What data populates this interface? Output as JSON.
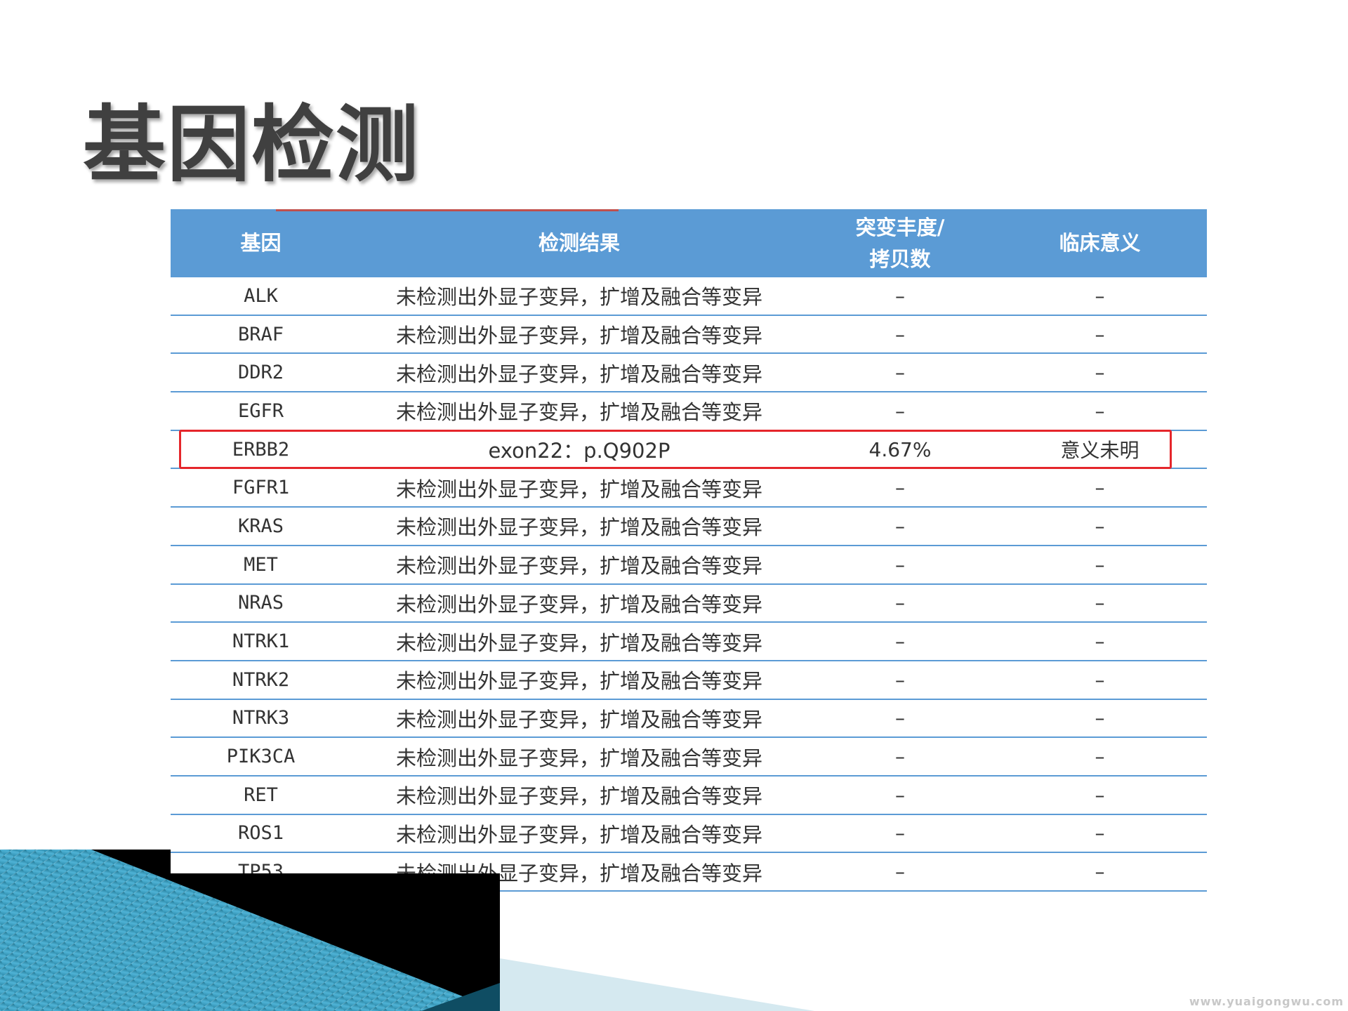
{
  "title": "基因检测",
  "table": {
    "headers": [
      "基因",
      "检测结果",
      "突变丰度/\n拷贝数",
      "临床意义"
    ],
    "rows": [
      {
        "gene": "ALK",
        "result": "未检测出外显子变异，扩增及融合等变异",
        "abundance": "–",
        "significance": "–"
      },
      {
        "gene": "BRAF",
        "result": "未检测出外显子变异，扩增及融合等变异",
        "abundance": "–",
        "significance": "–"
      },
      {
        "gene": "DDR2",
        "result": "未检测出外显子变异，扩增及融合等变异",
        "abundance": "–",
        "significance": "–"
      },
      {
        "gene": "EGFR",
        "result": "未检测出外显子变异，扩增及融合等变异",
        "abundance": "–",
        "significance": "–"
      },
      {
        "gene": "ERBB2",
        "result": "exon22：p.Q902P",
        "abundance": "4.67%",
        "significance": "意义未明"
      },
      {
        "gene": "FGFR1",
        "result": "未检测出外显子变异，扩增及融合等变异",
        "abundance": "–",
        "significance": "–"
      },
      {
        "gene": "KRAS",
        "result": "未检测出外显子变异，扩增及融合等变异",
        "abundance": "–",
        "significance": "–"
      },
      {
        "gene": "MET",
        "result": "未检测出外显子变异，扩增及融合等变异",
        "abundance": "–",
        "significance": "–"
      },
      {
        "gene": "NRAS",
        "result": "未检测出外显子变异，扩增及融合等变异",
        "abundance": "–",
        "significance": "–"
      },
      {
        "gene": "NTRK1",
        "result": "未检测出外显子变异，扩增及融合等变异",
        "abundance": "–",
        "significance": "–"
      },
      {
        "gene": "NTRK2",
        "result": "未检测出外显子变异，扩增及融合等变异",
        "abundance": "–",
        "significance": "–"
      },
      {
        "gene": "NTRK3",
        "result": "未检测出外显子变异，扩增及融合等变异",
        "abundance": "–",
        "significance": "–"
      },
      {
        "gene": "PIK3CA",
        "result": "未检测出外显子变异，扩增及融合等变异",
        "abundance": "–",
        "significance": "–"
      },
      {
        "gene": "RET",
        "result": "未检测出外显子变异，扩增及融合等变异",
        "abundance": "–",
        "significance": "–"
      },
      {
        "gene": "ROS1",
        "result": "未检测出外显子变异，扩增及融合等变异",
        "abundance": "–",
        "significance": "–"
      },
      {
        "gene": "TP53",
        "result": "未检测出外显子变异，扩增及融合等变异",
        "abundance": "–",
        "significance": "–"
      }
    ]
  },
  "highlight": {
    "gene": "ERBB2",
    "color": "#e5262b"
  },
  "colors": {
    "header_bg": "#5b9bd5",
    "row_border": "#5b9bd5",
    "title": "#404040"
  },
  "watermark": "www.yuaigongwu.com"
}
